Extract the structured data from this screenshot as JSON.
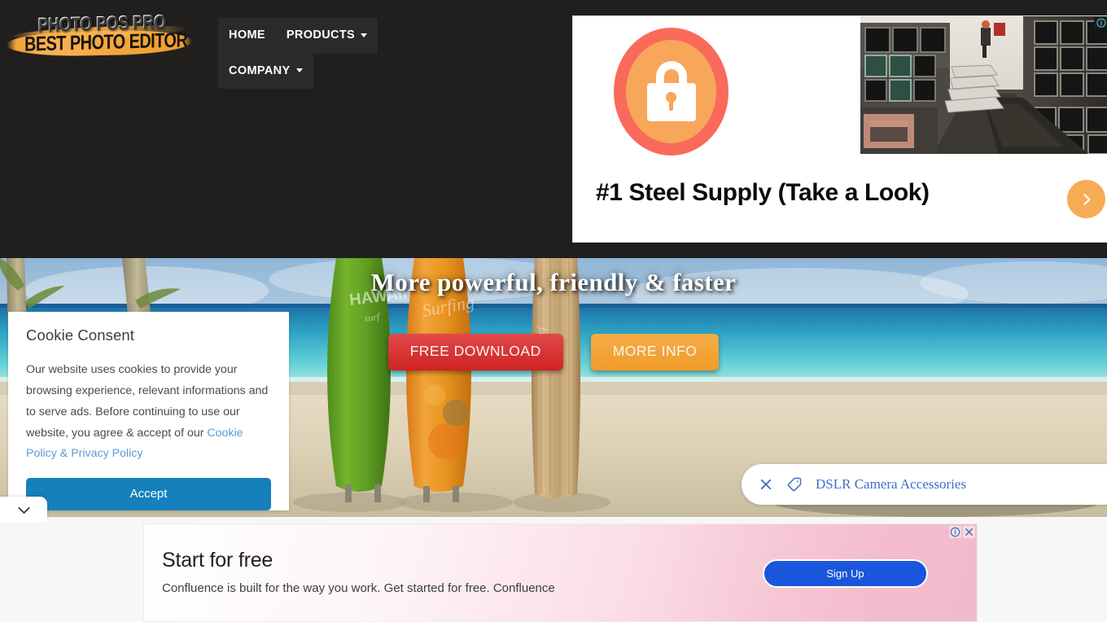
{
  "header": {
    "logo": {
      "line1": "PHOTO POS PRO",
      "line2": "BEST PHOTO EDITOR"
    },
    "nav": [
      {
        "label": "HOME",
        "has_caret": false
      },
      {
        "label": "PRODUCTS",
        "has_caret": true
      },
      {
        "label": "COMPANY",
        "has_caret": true
      }
    ]
  },
  "top_ad": {
    "headline": "#1 Steel Supply (Take a Look)",
    "icon": "padlock-icon",
    "image_alt": "stacked steel square tubes in warehouse",
    "arrow_label": "next",
    "adchoices_label": "AdChoices"
  },
  "hero": {
    "title": "More powerful, friendly & faster",
    "buttons": [
      {
        "label": "FREE DOWNLOAD",
        "color": "#cf2222"
      },
      {
        "label": "MORE INFO",
        "color": "#ef9c28"
      }
    ],
    "background_alt": "three surfboards on a tropical beach"
  },
  "cookie_consent": {
    "title": "Cookie Consent",
    "body_part1": "Our website uses cookies to provide your browsing experience, relevant informations and to serve ads. Before continuing to use our website, you agree & accept of our ",
    "link_text": "Cookie Policy & Privacy Policy",
    "accept_label": "Accept",
    "accept_color": "#1580bb"
  },
  "pull_tab": {
    "icon": "chevron-down-icon"
  },
  "dslr_pill": {
    "text": "DSLR Camera Accessories",
    "close_icon": "close-icon",
    "tag_icon": "tag-icon",
    "text_color": "#3d6fc4"
  },
  "bottom_ad": {
    "title": "Start for free",
    "subtitle": "Confluence is built for the way you work. Get started for free. Confluence",
    "cta_label": "Sign Up",
    "cta_color": "#1a56db",
    "info_icon": "info-icon",
    "close_icon": "close-icon"
  }
}
